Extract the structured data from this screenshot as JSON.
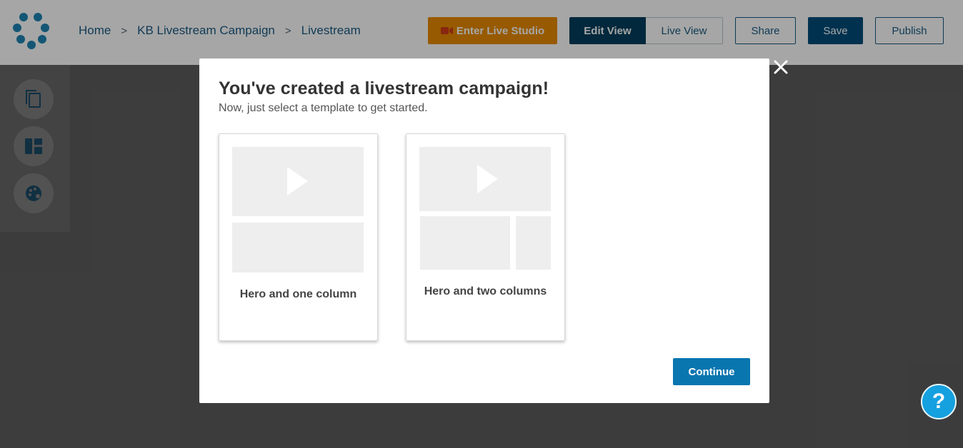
{
  "header": {
    "breadcrumb": [
      "Home",
      "KB Livestream Campaign",
      "Livestream"
    ],
    "breadcrumb_sep": ">",
    "enter_live_studio": "Enter Live Studio",
    "edit_view": "Edit View",
    "live_view": "Live View",
    "share": "Share",
    "save": "Save",
    "publish": "Publish"
  },
  "rail": {
    "items": [
      "copy-icon",
      "layout-icon",
      "palette-icon"
    ]
  },
  "modal": {
    "title": "You've created a livestream campaign!",
    "subtitle": "Now, just select a template to get started.",
    "templates": [
      {
        "label": "Hero and one column"
      },
      {
        "label": "Hero and two columns"
      }
    ],
    "continue": "Continue"
  },
  "help": "?",
  "colors": {
    "accent": "#0a76b0",
    "live_studio": "#e88b00",
    "edit_view": "#023e5c",
    "help": "#15a0e0"
  }
}
